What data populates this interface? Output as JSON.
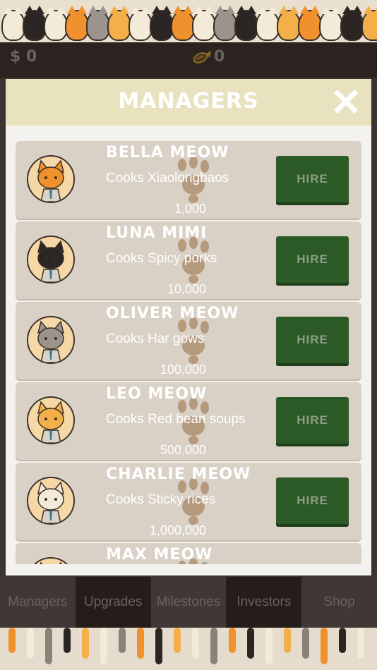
{
  "header": {
    "money": "$ 0",
    "fish_count": "0"
  },
  "modal": {
    "title": "MANAGERS",
    "close_label": "X",
    "managers": [
      {
        "name": "BELLA MEOW",
        "task": "Cooks Xiaolongbaos",
        "cost": "1,000",
        "hire_label": "HIRE",
        "fur": "#f0912e"
      },
      {
        "name": "LUNA MIMI",
        "task": "Cooks Spicy porks",
        "cost": "10,000",
        "hire_label": "HIRE",
        "fur": "#2b2624"
      },
      {
        "name": "OLIVER MEOW",
        "task": "Cooks Har gows",
        "cost": "100,000",
        "hire_label": "HIRE",
        "fur": "#9a948c"
      },
      {
        "name": "LEO MEOW",
        "task": "Cooks Red bean soups",
        "cost": "500,000",
        "hire_label": "HIRE",
        "fur": "#f3b04a"
      },
      {
        "name": "CHARLIE MEOW",
        "task": "Cooks Sticky rices",
        "cost": "1,000,000",
        "hire_label": "HIRE",
        "fur": "#f4ead8"
      },
      {
        "name": "MAX MEOW",
        "task": "",
        "cost": "",
        "hire_label": "",
        "fur": "#f3b04a"
      }
    ]
  },
  "tabs": [
    "Managers",
    "Upgrades",
    "Milestones",
    "Investors",
    "Shop"
  ],
  "colors": {
    "card": "#d9d0c6",
    "hire_button": "#2c5a26",
    "header_band": "#e8e2bf"
  }
}
